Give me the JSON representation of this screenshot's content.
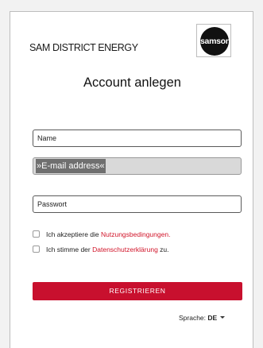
{
  "header": {
    "brand_text": "SAM DISTRICT ENERGY",
    "logo_text": "samson",
    "title": "Account anlegen"
  },
  "form": {
    "name": {
      "value": "Name"
    },
    "email": {
      "value": "»E-mail address«",
      "selected": true
    },
    "password": {
      "value": "Passwort"
    },
    "terms": {
      "prefix": "Ich akzeptiere die ",
      "link": "Nutzungsbedingungen",
      "suffix": ".",
      "checked": false
    },
    "privacy": {
      "prefix": "Ich stimme der ",
      "link": "Datenschutzerklärung",
      "suffix": " zu.",
      "checked": false
    },
    "submit_label": "REGISTRIEREN"
  },
  "language": {
    "label": "Sprache:",
    "value": "DE",
    "icon": "chevron-down-icon"
  },
  "colors": {
    "accent": "#c8102e",
    "link": "#d1152a",
    "field_border": "#5a5a5a",
    "selection": "#6f6f6f"
  }
}
